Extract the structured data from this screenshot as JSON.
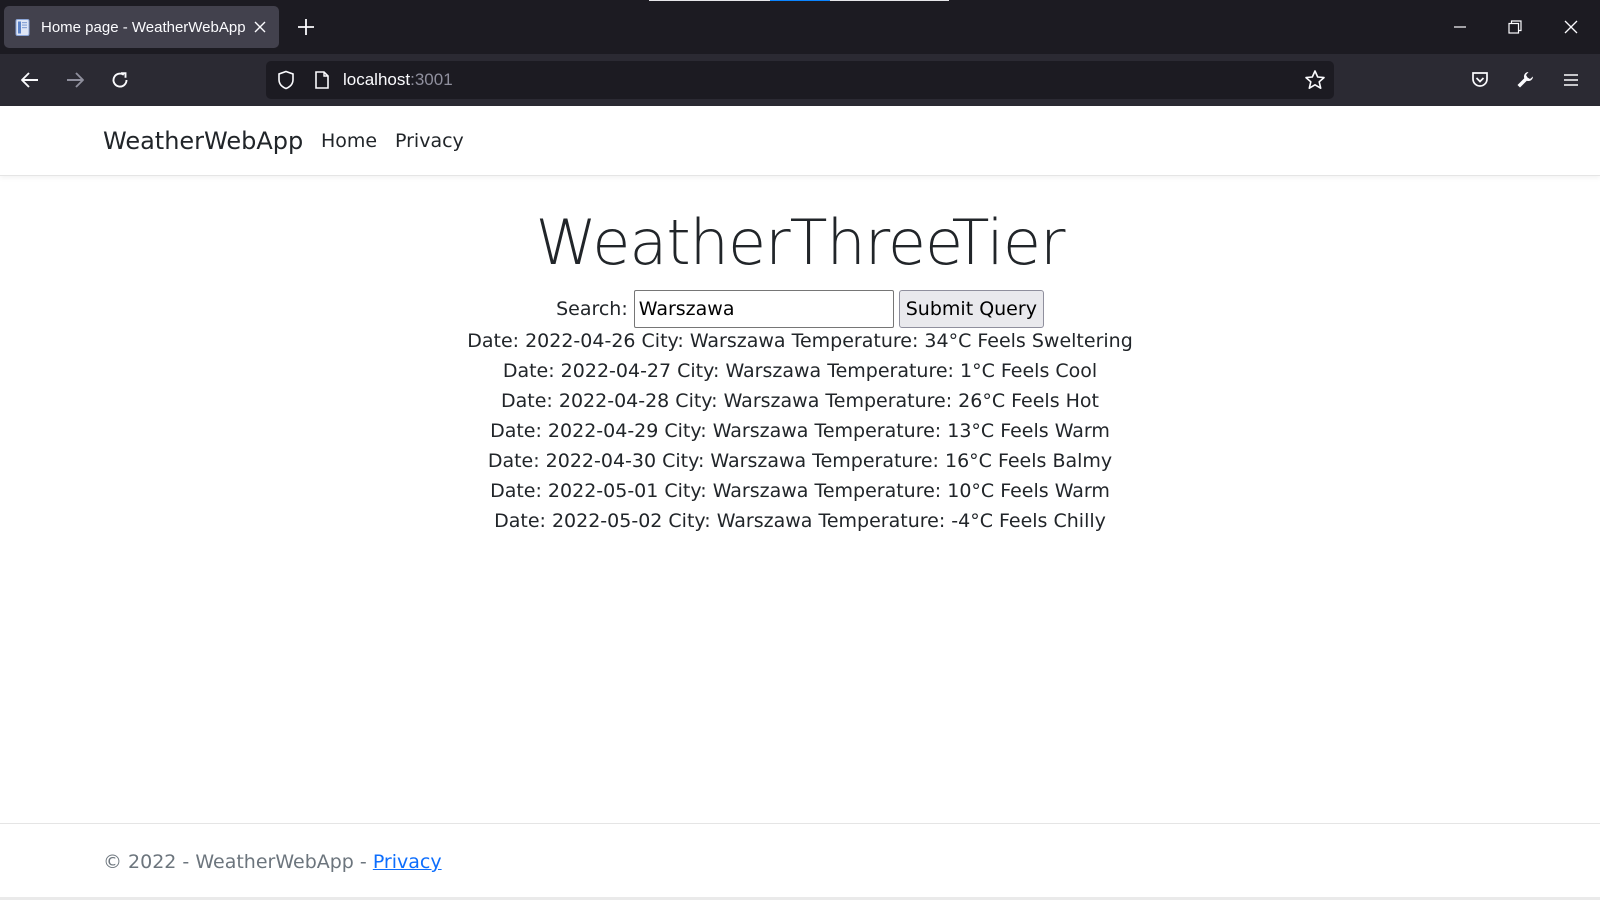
{
  "browser": {
    "tab": {
      "title": "Home page - WeatherWebApp",
      "favicon": "page-icon",
      "close": "close-icon"
    },
    "new_tab": "plus-icon",
    "window_controls": [
      "minimize-icon",
      "restore-icon",
      "close-icon"
    ],
    "nav": [
      "back-arrow-icon",
      "forward-arrow-icon",
      "reload-icon"
    ],
    "url": {
      "host": "localhost",
      "port": ":3001"
    },
    "toolbar_icons": [
      "pocket-icon",
      "wrench-icon",
      "hamburger-menu-icon"
    ],
    "colors": {
      "tabbar": "#1c1b22",
      "toolbar": "#2b2a33",
      "active_tab": "#42414d",
      "text": "#fbfbfe"
    }
  },
  "header": {
    "brand": "WeatherWebApp",
    "nav": [
      {
        "label": "Home"
      },
      {
        "label": "Privacy"
      }
    ]
  },
  "main": {
    "title": "WeatherThreeTier",
    "search": {
      "label": "Search:",
      "value": "Warszawa",
      "button": "Submit Query"
    },
    "results": [
      "Date: 2022-04-26 City: Warszawa Temperature: 34°C Feels Sweltering",
      "Date: 2022-04-27 City: Warszawa Temperature: 1°C Feels Cool",
      "Date: 2022-04-28 City: Warszawa Temperature: 26°C Feels Hot",
      "Date: 2022-04-29 City: Warszawa Temperature: 13°C Feels Warm",
      "Date: 2022-04-30 City: Warszawa Temperature: 16°C Feels Balmy",
      "Date: 2022-05-01 City: Warszawa Temperature: 10°C Feels Warm",
      "Date: 2022-05-02 City: Warszawa Temperature: -4°C Feels Chilly"
    ]
  },
  "footer": {
    "text": "© 2022 - WeatherWebApp - ",
    "link": "Privacy",
    "link_color": "#0d6efd"
  }
}
